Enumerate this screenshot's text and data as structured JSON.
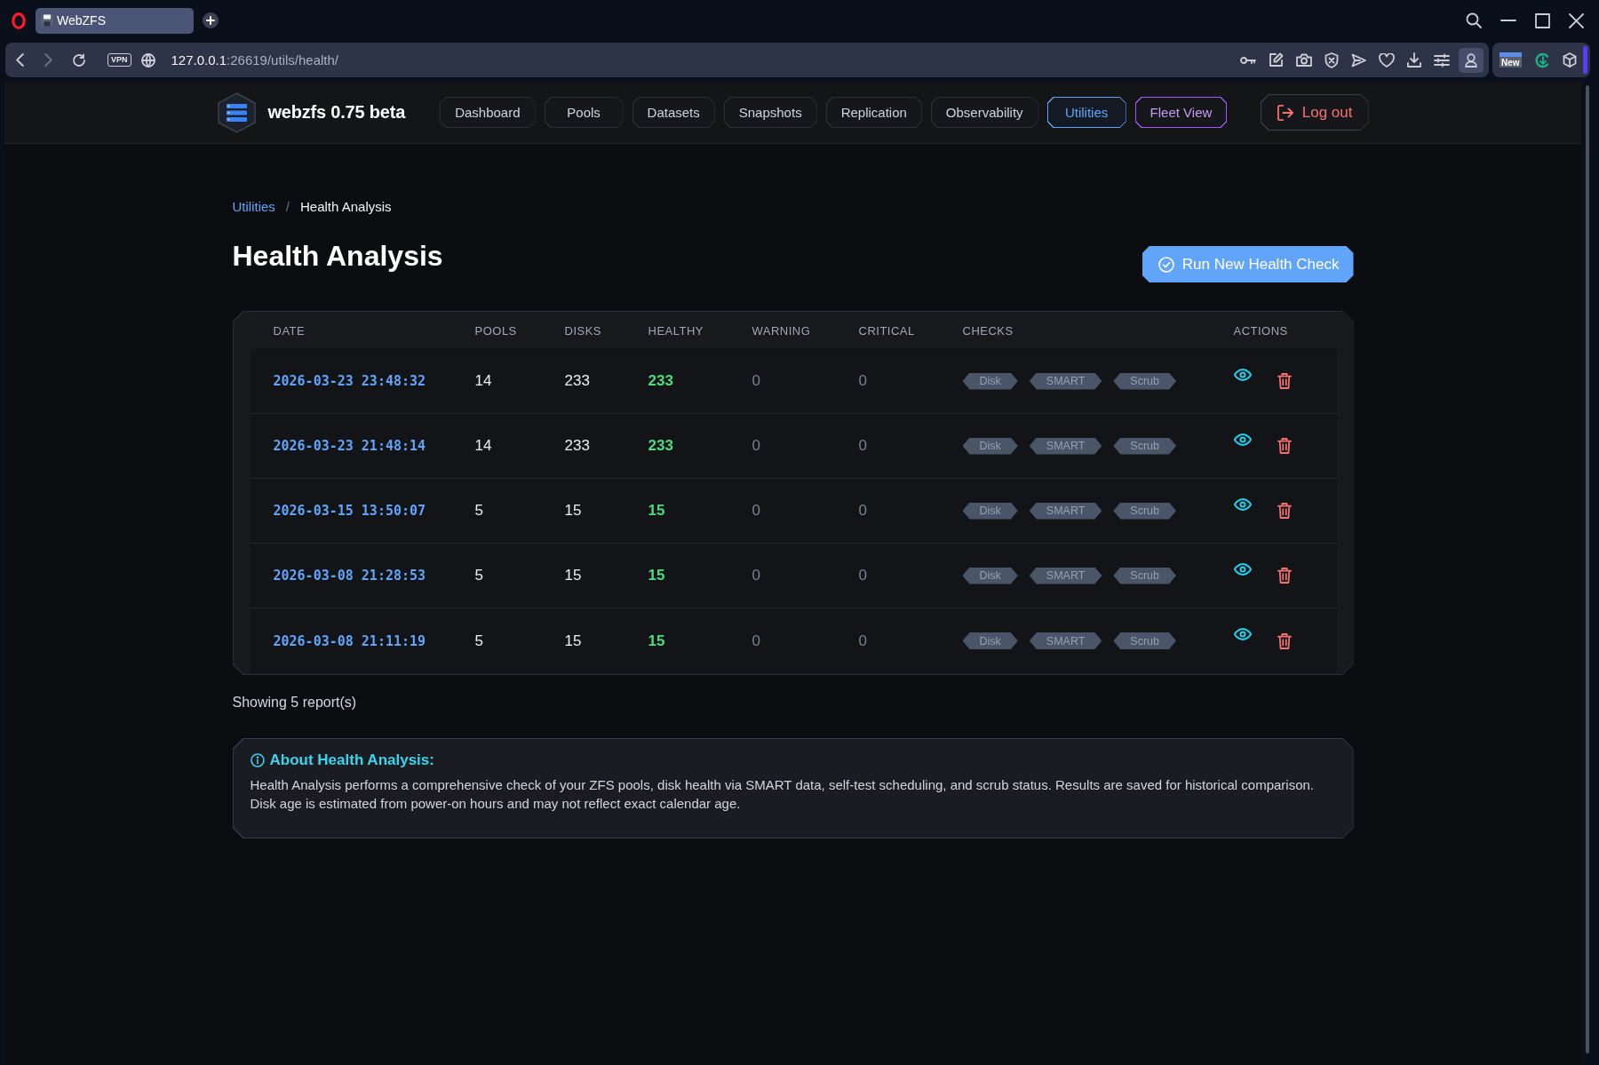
{
  "browser": {
    "tab": {
      "title": "WebZFS"
    },
    "address_bar": {
      "vpn_label": "VPN",
      "host": "127.0.0.1",
      "path": ":26619/utils/health/"
    },
    "extension_label": "New"
  },
  "navbar": {
    "brand": "webzfs 0.75 beta",
    "nav_items": [
      {
        "label": "Dashboard",
        "kind": "page",
        "selected": false
      },
      {
        "label": "Pools",
        "kind": "page",
        "selected": false
      },
      {
        "label": "Datasets",
        "kind": "page",
        "selected": false
      },
      {
        "label": "Snapshots",
        "kind": "page",
        "selected": false
      },
      {
        "label": "Replication",
        "kind": "page",
        "selected": false
      },
      {
        "label": "Observability",
        "kind": "page",
        "selected": false
      },
      {
        "label": "Utilities",
        "kind": "page",
        "selected": true
      },
      {
        "label": "Fleet View",
        "kind": "fleet",
        "selected": false
      }
    ],
    "logout": "Log out"
  },
  "breadcrumb": {
    "items": [
      {
        "label": "Utilities",
        "kind": "link"
      },
      {
        "label": "Health Analysis",
        "kind": "current"
      }
    ],
    "separator": "/"
  },
  "page_title": "Health Analysis",
  "run_button": "Run New Health Check",
  "table": {
    "columns": [
      "DATE",
      "POOLS",
      "DISKS",
      "HEALTHY",
      "WARNING",
      "CRITICAL",
      "CHECKS",
      "ACTIONS"
    ],
    "rows": [
      {
        "date": "2026-03-23 23:48:32",
        "pools": "14",
        "disks": "233",
        "healthy": "233",
        "warning": "0",
        "critical": "0",
        "checks": [
          "Disk",
          "SMART",
          "Scrub"
        ]
      },
      {
        "date": "2026-03-23 21:48:14",
        "pools": "14",
        "disks": "233",
        "healthy": "233",
        "warning": "0",
        "critical": "0",
        "checks": [
          "Disk",
          "SMART",
          "Scrub"
        ]
      },
      {
        "date": "2026-03-15 13:50:07",
        "pools": "5",
        "disks": "15",
        "healthy": "15",
        "warning": "0",
        "critical": "0",
        "checks": [
          "Disk",
          "SMART",
          "Scrub"
        ]
      },
      {
        "date": "2026-03-08 21:28:53",
        "pools": "5",
        "disks": "15",
        "healthy": "15",
        "warning": "0",
        "critical": "0",
        "checks": [
          "Disk",
          "SMART",
          "Scrub"
        ]
      },
      {
        "date": "2026-03-08 21:11:19",
        "pools": "5",
        "disks": "15",
        "healthy": "15",
        "warning": "0",
        "critical": "0",
        "checks": [
          "Disk",
          "SMART",
          "Scrub"
        ]
      }
    ]
  },
  "summary": "Showing 5 report(s)",
  "about": {
    "title": "About Health Analysis:",
    "text": "Health Analysis performs a comprehensive check of your ZFS pools, disk health via SMART data, self-test scheduling, and scrub status. Results are saved for historical comparison. Disk age is estimated from power-on hours and may not reflect exact calendar age."
  }
}
